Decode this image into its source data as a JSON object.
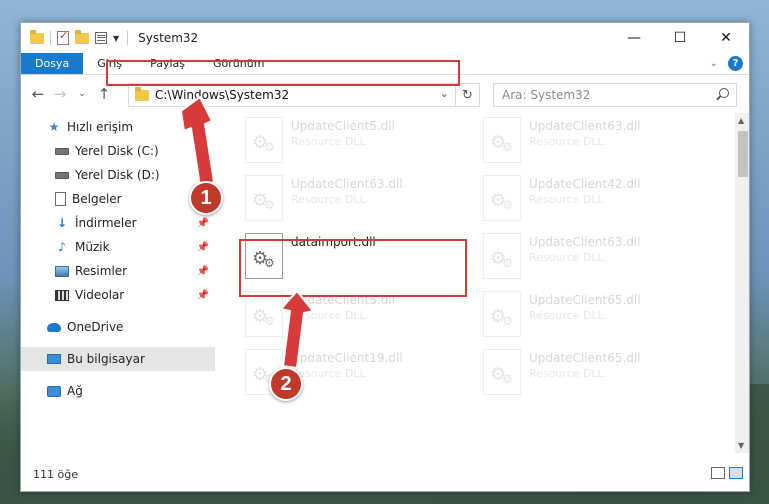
{
  "window": {
    "title": "System32",
    "controls": {
      "minimize": "—",
      "maximize": "☐",
      "close": "✕"
    }
  },
  "ribbon": {
    "tabs": [
      "Dosya",
      "Giriş",
      "Paylaş",
      "Görünüm"
    ],
    "active_tab": "Dosya"
  },
  "address": {
    "path": "C:\\Windows\\System32",
    "search_placeholder": "Ara: System32"
  },
  "sidebar": {
    "items": [
      {
        "label": "Hızlı erişim",
        "icon": "star-icon"
      },
      {
        "label": "Yerel Disk (C:)",
        "icon": "drive-icon",
        "pinned": true
      },
      {
        "label": "Yerel Disk (D:)",
        "icon": "drive-icon"
      },
      {
        "label": "Belgeler",
        "icon": "documents-icon",
        "pinned": true
      },
      {
        "label": "İndirmeler",
        "icon": "downloads-icon",
        "pinned": true
      },
      {
        "label": "Müzik",
        "icon": "music-icon",
        "pinned": true
      },
      {
        "label": "Resimler",
        "icon": "pictures-icon",
        "pinned": true
      },
      {
        "label": "Videolar",
        "icon": "videos-icon",
        "pinned": true
      },
      {
        "label": "OneDrive",
        "icon": "cloud-icon"
      },
      {
        "label": "Bu bilgisayar",
        "icon": "computer-icon",
        "selected": true
      },
      {
        "label": "Ağ",
        "icon": "network-icon"
      }
    ]
  },
  "files": [
    {
      "name": "UpdateClient5.dll",
      "desc": "Resource DLL",
      "ghost": true
    },
    {
      "name": "UpdateClient63.dll",
      "desc": "Resource DLL",
      "ghost": true
    },
    {
      "name": "UpdateClient63.dll",
      "desc": "Resource DLL",
      "ghost": true
    },
    {
      "name": "UpdateClient42.dll",
      "desc": "Resource DLL",
      "ghost": true
    },
    {
      "name": "dataimport.dll",
      "desc": "",
      "ghost": false
    },
    {
      "name": "UpdateClient63.dll",
      "desc": "Resource DLL",
      "ghost": true
    },
    {
      "name": "UpdateClient5.dll",
      "desc": "Resource DLL",
      "ghost": true
    },
    {
      "name": "UpdateClient65.dll",
      "desc": "Resource DLL",
      "ghost": true
    },
    {
      "name": "UpdateClient19.dll",
      "desc": "Resource DLL",
      "ghost": true
    },
    {
      "name": "UpdateClient65.dll",
      "desc": "Resource DLL",
      "ghost": true
    }
  ],
  "status": {
    "item_count": "111 öğe"
  },
  "annotations": [
    {
      "number": "1",
      "target": "address-bar"
    },
    {
      "number": "2",
      "target": "dataimport.dll"
    }
  ],
  "colors": {
    "accent": "#1979ca",
    "highlight": "#d63a3a",
    "badge": "#c0392b"
  }
}
